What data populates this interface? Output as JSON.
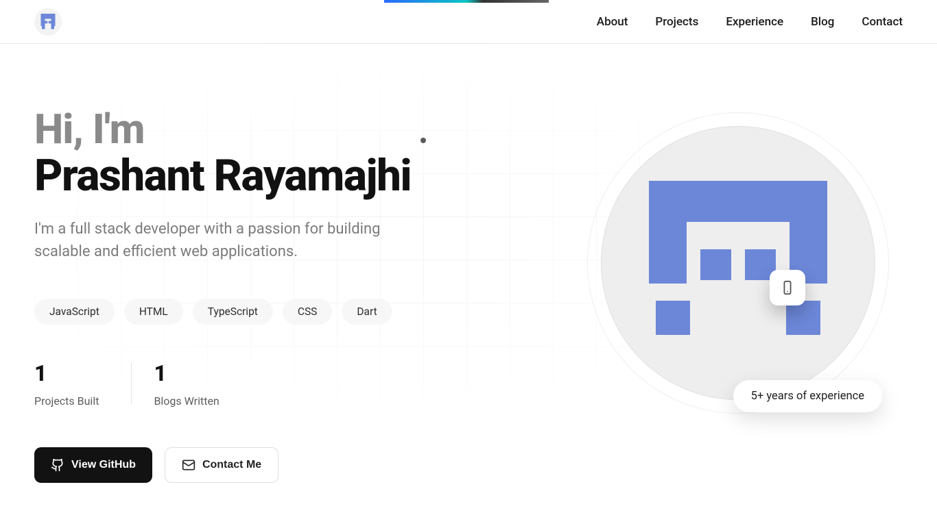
{
  "nav": {
    "items": [
      {
        "label": "About"
      },
      {
        "label": "Projects"
      },
      {
        "label": "Experience"
      },
      {
        "label": "Blog"
      },
      {
        "label": "Contact"
      }
    ]
  },
  "hero": {
    "greet": "Hi, I'm",
    "name": "Prashant Rayamajhi",
    "tagline": "I'm a full stack developer with a passion for building scalable and efficient web applications."
  },
  "skills": [
    "JavaScript",
    "HTML",
    "TypeScript",
    "CSS",
    "Dart"
  ],
  "stats": [
    {
      "value": "1",
      "label": "Projects Built"
    },
    {
      "value": "1",
      "label": "Blogs Written"
    }
  ],
  "buttons": {
    "github": "View GitHub",
    "contact": "Contact Me"
  },
  "badge": {
    "experience": "5+ years of experience"
  }
}
